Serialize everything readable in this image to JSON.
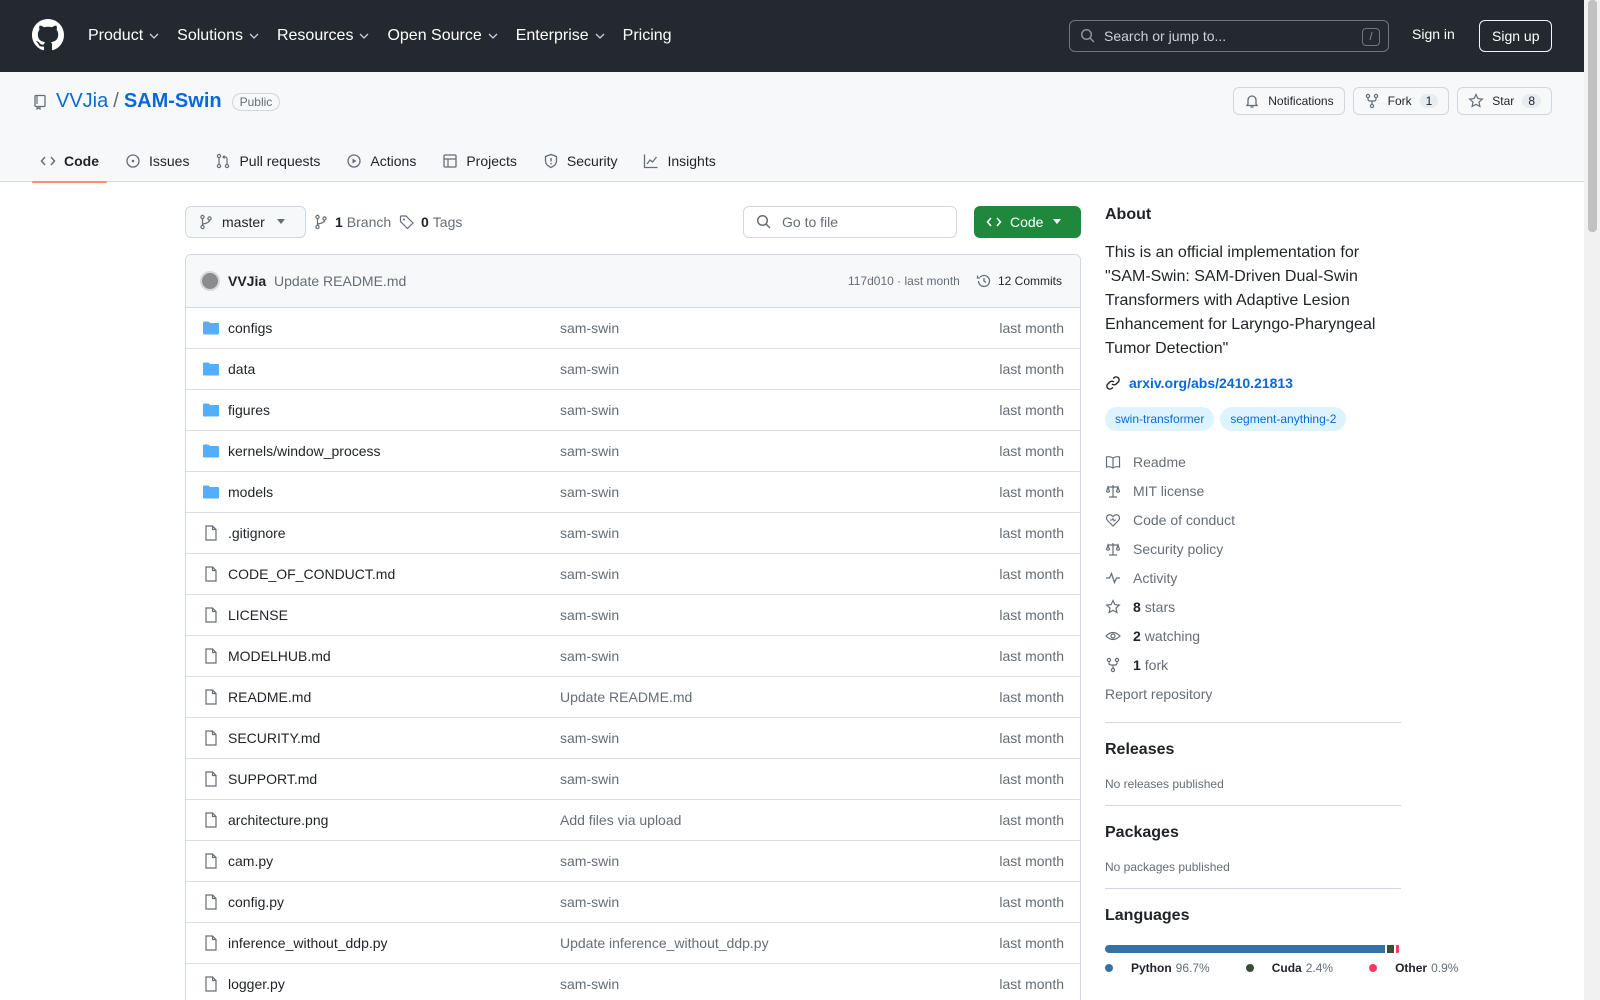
{
  "colors": {
    "header_bg": "#24292f",
    "link": "#0969da",
    "primary_btn": "#1f883d",
    "tab_underline": "#fd8c73"
  },
  "topnav": {
    "items": [
      "Product",
      "Solutions",
      "Resources",
      "Open Source",
      "Enterprise",
      "Pricing"
    ],
    "search_placeholder": "Search or jump to...",
    "search_hotkey": "/",
    "sign_in": "Sign in",
    "sign_up": "Sign up"
  },
  "repo": {
    "owner": "VVJia",
    "separator": "/",
    "name": "SAM-Swin",
    "visibility": "Public",
    "actions": {
      "notifications": "Notifications",
      "fork": "Fork",
      "fork_count": "1",
      "star": "Star",
      "star_count": "8"
    },
    "tabs": [
      "Code",
      "Issues",
      "Pull requests",
      "Actions",
      "Projects",
      "Security",
      "Insights"
    ],
    "tab_icons": [
      "code-icon",
      "issue-icon",
      "pull-request-icon",
      "play-icon",
      "table-icon",
      "shield-icon",
      "graph-icon"
    ]
  },
  "toolbar": {
    "branch": "master",
    "branch_count": "1",
    "branch_label": "Branch",
    "tag_count": "0",
    "tag_label": "Tags",
    "goto_placeholder": "Go to file",
    "code_label": "Code"
  },
  "commit": {
    "author": "VVJia",
    "message": "Update README.md",
    "hash_time": "117d010 · last month",
    "commits_label": "12 Commits"
  },
  "files": [
    {
      "type": "folder",
      "name": "configs",
      "message": "sam-swin",
      "date": "last month"
    },
    {
      "type": "folder",
      "name": "data",
      "message": "sam-swin",
      "date": "last month"
    },
    {
      "type": "folder",
      "name": "figures",
      "message": "sam-swin",
      "date": "last month"
    },
    {
      "type": "folder",
      "name": "kernels/window_process",
      "message": "sam-swin",
      "date": "last month"
    },
    {
      "type": "folder",
      "name": "models",
      "message": "sam-swin",
      "date": "last month"
    },
    {
      "type": "file",
      "name": ".gitignore",
      "message": "sam-swin",
      "date": "last month"
    },
    {
      "type": "file",
      "name": "CODE_OF_CONDUCT.md",
      "message": "sam-swin",
      "date": "last month"
    },
    {
      "type": "file",
      "name": "LICENSE",
      "message": "sam-swin",
      "date": "last month"
    },
    {
      "type": "file",
      "name": "MODELHUB.md",
      "message": "sam-swin",
      "date": "last month"
    },
    {
      "type": "file",
      "name": "README.md",
      "message": "Update README.md",
      "date": "last month"
    },
    {
      "type": "file",
      "name": "SECURITY.md",
      "message": "sam-swin",
      "date": "last month"
    },
    {
      "type": "file",
      "name": "SUPPORT.md",
      "message": "sam-swin",
      "date": "last month"
    },
    {
      "type": "file",
      "name": "architecture.png",
      "message": "Add files via upload",
      "date": "last month"
    },
    {
      "type": "file",
      "name": "cam.py",
      "message": "sam-swin",
      "date": "last month"
    },
    {
      "type": "file",
      "name": "config.py",
      "message": "sam-swin",
      "date": "last month"
    },
    {
      "type": "file",
      "name": "inference_without_ddp.py",
      "message": "Update inference_without_ddp.py",
      "date": "last month"
    },
    {
      "type": "file",
      "name": "logger.py",
      "message": "sam-swin",
      "date": "last month"
    }
  ],
  "sidebar": {
    "about_title": "About",
    "description": "This is an official implementation for \"SAM-Swin: SAM-Driven Dual-Swin Transformers with Adaptive Lesion Enhancement for Laryngo-Pharyngeal Tumor Detection\"",
    "link": "arxiv.org/abs/2410.21813",
    "topics": [
      "swin-transformer",
      "segment-anything-2"
    ],
    "meta": [
      {
        "icon": "book-icon",
        "bold": "",
        "label": "Readme"
      },
      {
        "icon": "scale-icon",
        "bold": "",
        "label": "MIT license"
      },
      {
        "icon": "heart-icon",
        "bold": "",
        "label": "Code of conduct"
      },
      {
        "icon": "scale-icon",
        "bold": "",
        "label": "Security policy"
      },
      {
        "icon": "pulse-icon",
        "bold": "",
        "label": "Activity"
      },
      {
        "icon": "star-icon",
        "bold": "8",
        "label": "stars"
      },
      {
        "icon": "eye-icon",
        "bold": "2",
        "label": "watching"
      },
      {
        "icon": "fork-icon",
        "bold": "1",
        "label": "fork"
      }
    ],
    "report": "Report repository",
    "releases_title": "Releases",
    "releases_empty": "No releases published",
    "packages_title": "Packages",
    "packages_empty": "No packages published",
    "languages_title": "Languages",
    "languages": [
      {
        "name": "Python",
        "percent": "96.7%",
        "value": 96.7,
        "color": "#3572A5"
      },
      {
        "name": "Cuda",
        "percent": "2.4%",
        "value": 2.4,
        "color": "#3A4E3A"
      },
      {
        "name": "Other",
        "percent": "0.9%",
        "value": 0.9,
        "color": "#ff3a5c"
      }
    ]
  }
}
